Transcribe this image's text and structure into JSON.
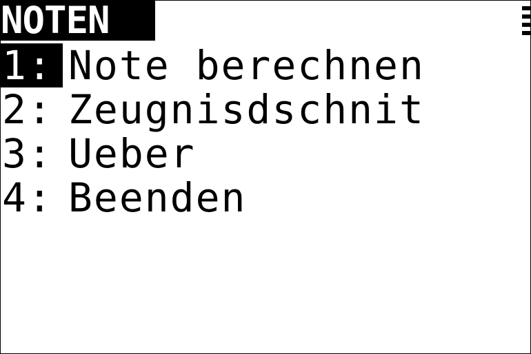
{
  "title": "NOTEN",
  "menu": {
    "items": [
      {
        "number": "1:",
        "label": "Note berechnen",
        "selected": true
      },
      {
        "number": "2:",
        "label": "Zeugnisdschnit",
        "selected": false
      },
      {
        "number": "3:",
        "label": "Ueber",
        "selected": false
      },
      {
        "number": "4:",
        "label": "Beenden",
        "selected": false
      }
    ]
  },
  "colors": {
    "foreground": "#000000",
    "background": "#ffffff"
  },
  "icons": {
    "more-indicator": "more-items-indicator-icon"
  }
}
